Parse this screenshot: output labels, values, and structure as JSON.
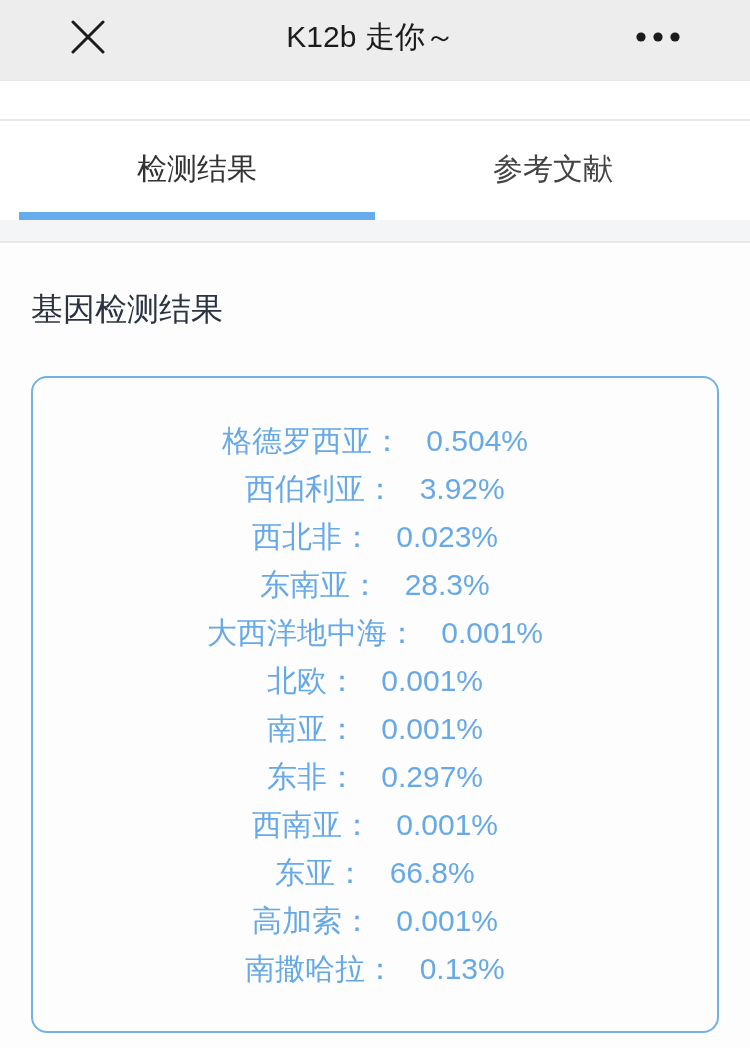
{
  "nav_bar": {
    "title": "K12b 走你～"
  },
  "tabs": [
    {
      "label": "检测结果",
      "selected": true
    },
    {
      "label": "参考文献",
      "selected": false
    }
  ],
  "section": {
    "heading": "基因检测结果",
    "results": [
      "格德罗西亚： 0.504%",
      "西伯利亚： 3.92%",
      "西北非： 0.023%",
      "东南亚： 28.3%",
      "大西洋地中海： 0.001%",
      "北欧： 0.001%",
      "南亚： 0.001%",
      "东非： 0.297%",
      "西南亚： 0.001%",
      "东亚： 66.8%",
      "高加索： 0.001%",
      "南撒哈拉： 0.13%"
    ]
  }
}
